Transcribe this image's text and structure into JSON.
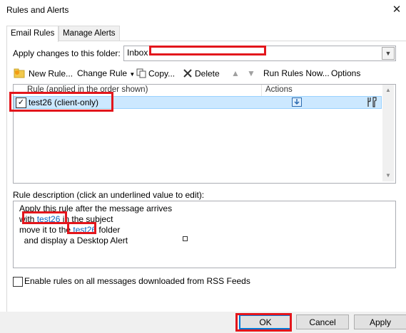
{
  "window": {
    "title": "Rules and Alerts",
    "close_glyph": "✕"
  },
  "tabs": [
    {
      "label": "Email Rules"
    },
    {
      "label": "Manage Alerts"
    }
  ],
  "folder": {
    "label": "Apply changes to this folder:",
    "value": "Inbox",
    "dropdown_icon": "chevron-down-icon"
  },
  "toolbar": {
    "new_rule": "New Rule...",
    "change_rule": "Change Rule",
    "copy": "Copy...",
    "delete": "Delete",
    "run_rules": "Run Rules Now...",
    "options": "Options"
  },
  "rules_list": {
    "col_rule": "Rule (applied in the order shown)",
    "col_actions": "Actions",
    "rows": [
      {
        "name": "test26  (client-only)",
        "checked": true
      }
    ]
  },
  "description": {
    "label": "Rule description (click an underlined value to edit):",
    "line1": "Apply this rule after the message arrives",
    "line2_pre": "with ",
    "line2_link": "test26",
    "line2_post": " in the subject",
    "line3_pre": "move it to the ",
    "line3_link": "test26",
    "line3_post": " folder",
    "line4": "  and display a Desktop Alert"
  },
  "rss": {
    "label": "Enable rules on all messages downloaded from RSS Feeds",
    "checked": false
  },
  "buttons": {
    "ok": "OK",
    "cancel": "Cancel",
    "apply": "Apply"
  },
  "colors": {
    "selection": "#cce8ff",
    "redaction": "#e3161c",
    "link": "#0563c1"
  }
}
